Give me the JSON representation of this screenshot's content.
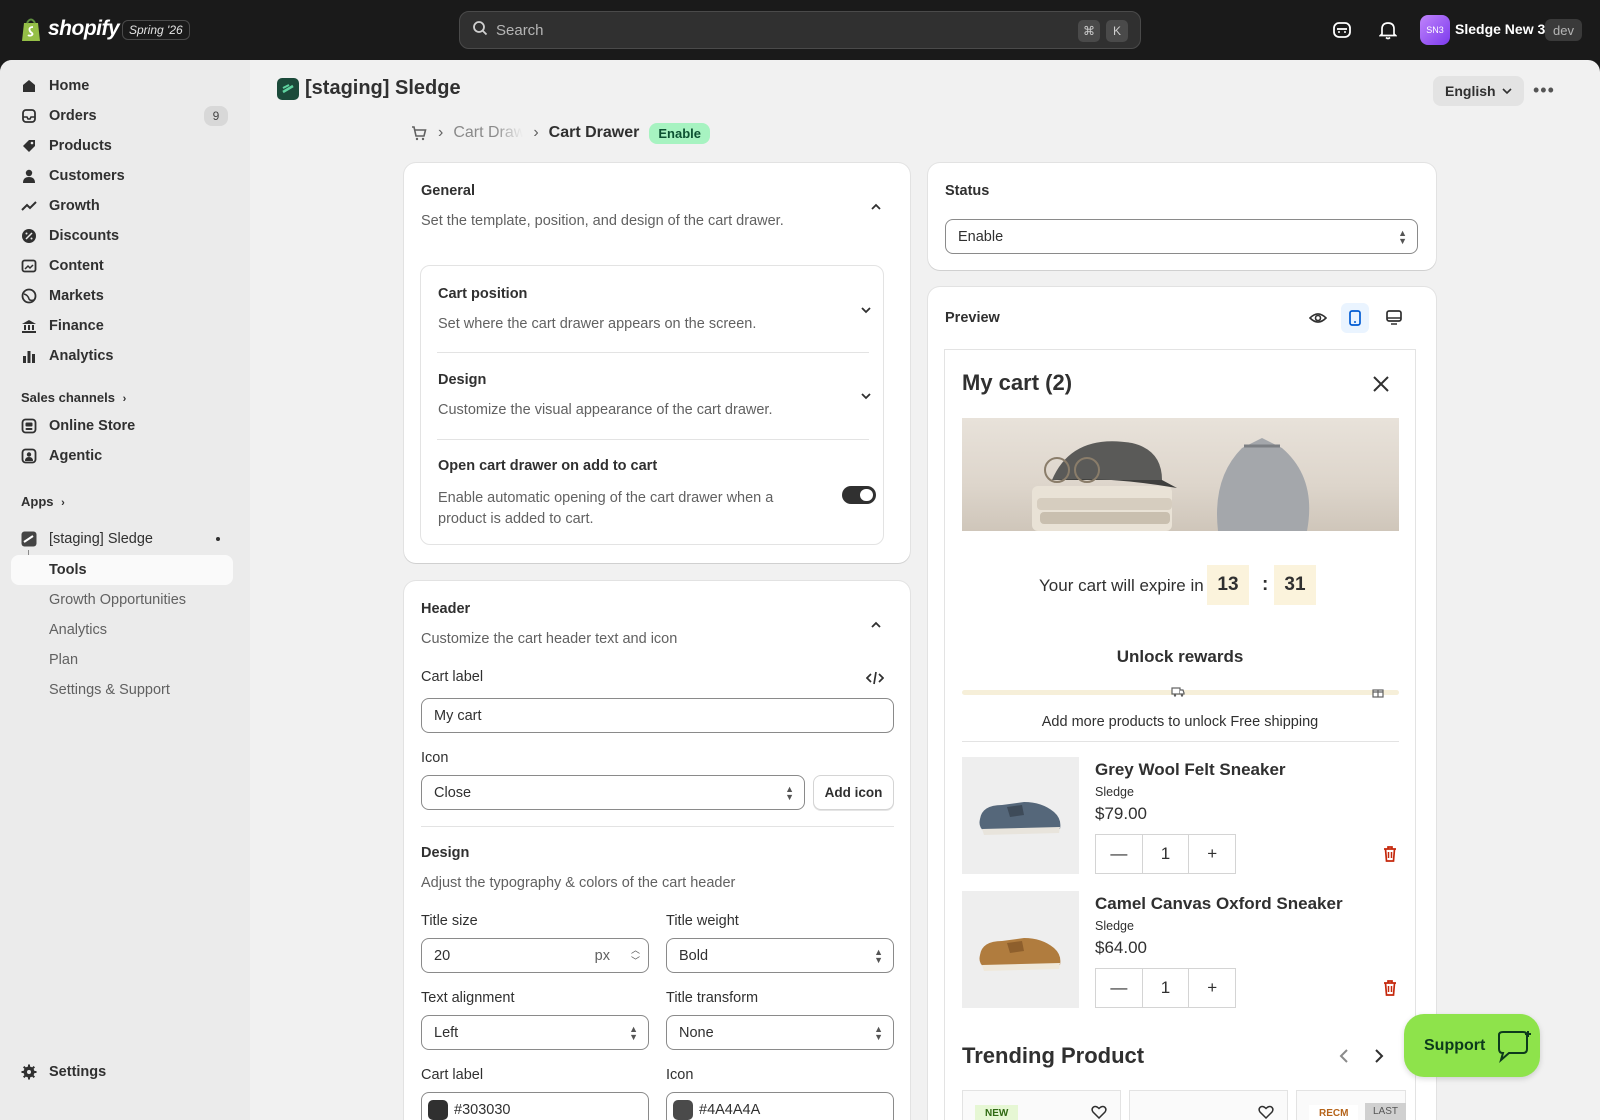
{
  "topbar": {
    "brand": "shopify",
    "season": "Spring '26",
    "search_placeholder": "Search",
    "shortcut_cmd": "⌘",
    "shortcut_key": "K",
    "avatar_initials": "SN3",
    "store_name": "Sledge New 3",
    "env_badge": "dev"
  },
  "sidebar": {
    "items": [
      {
        "label": "Home",
        "icon": "home-icon"
      },
      {
        "label": "Orders",
        "icon": "inbox-icon",
        "count": "9"
      },
      {
        "label": "Products",
        "icon": "tag-icon"
      },
      {
        "label": "Customers",
        "icon": "person-icon"
      },
      {
        "label": "Growth",
        "icon": "growth-icon"
      },
      {
        "label": "Discounts",
        "icon": "discount-icon"
      },
      {
        "label": "Content",
        "icon": "content-icon"
      },
      {
        "label": "Markets",
        "icon": "globe-icon"
      },
      {
        "label": "Finance",
        "icon": "bank-icon"
      },
      {
        "label": "Analytics",
        "icon": "bar-chart-icon"
      }
    ],
    "sales_channels_label": "Sales channels",
    "channels": [
      {
        "label": "Online Store",
        "icon": "store-icon"
      },
      {
        "label": "Agentic",
        "icon": "agent-icon"
      }
    ],
    "apps_label": "Apps",
    "app_name": "[staging] Sledge",
    "app_subitems": [
      "Tools",
      "Growth Opportunities",
      "Analytics",
      "Plan",
      "Settings & Support"
    ],
    "settings_label": "Settings"
  },
  "page": {
    "app_title": "[staging] Sledge",
    "language": "English",
    "breadcrumb_parent": "Cart Drawer",
    "breadcrumb_current": "Cart Drawer",
    "status_pill": "Enable"
  },
  "general": {
    "title": "General",
    "description": "Set the template, position, and design of the cart drawer.",
    "cart_position_title": "Cart position",
    "cart_position_desc": "Set where the cart drawer appears on the screen.",
    "design_title": "Design",
    "design_desc": "Customize the visual appearance of the cart drawer.",
    "open_on_add_title": "Open cart drawer on add to cart",
    "open_on_add_desc": "Enable automatic opening of the cart drawer when a product is added to cart.",
    "open_on_add_enabled": true
  },
  "header_section": {
    "title": "Header",
    "description": "Customize the cart header text and icon",
    "cart_label_label": "Cart label",
    "cart_label_value": "My cart",
    "icon_label": "Icon",
    "icon_value": "Close",
    "add_icon_button": "Add icon",
    "design_title": "Design",
    "design_desc": "Adjust the typography & colors of the cart header",
    "title_size_label": "Title size",
    "title_size_value": "20",
    "title_size_unit": "px",
    "title_weight_label": "Title weight",
    "title_weight_value": "Bold",
    "text_alignment_label": "Text alignment",
    "text_alignment_value": "Left",
    "title_transform_label": "Title transform",
    "title_transform_value": "None",
    "color_cart_label_label": "Cart label",
    "color_cart_label_value": "#303030",
    "color_icon_label": "Icon",
    "color_icon_value": "#4A4A4A"
  },
  "status": {
    "title": "Status",
    "value": "Enable"
  },
  "preview": {
    "title": "Preview",
    "cart_title": "My cart (2)",
    "expire_text": "Your cart will expire in",
    "minutes": "13",
    "colon": ":",
    "seconds": "31",
    "rewards_title": "Unlock rewards",
    "rewards_text": "Add more products to unlock Free shipping",
    "products": [
      {
        "name": "Grey Wool Felt Sneaker",
        "vendor": "Sledge",
        "price": "$79.00",
        "qty": "1"
      },
      {
        "name": "Camel Canvas Oxford Sneaker",
        "vendor": "Sledge",
        "price": "$64.00",
        "qty": "1"
      }
    ],
    "trending_title": "Trending Product",
    "trending_badges": [
      "NEW",
      "RECM",
      "LAST"
    ]
  },
  "support_button": "Support",
  "colors": {
    "accent_green": "#8ee34b",
    "enable_pill": "#a7f3c1",
    "delete_red": "#c5280c"
  }
}
